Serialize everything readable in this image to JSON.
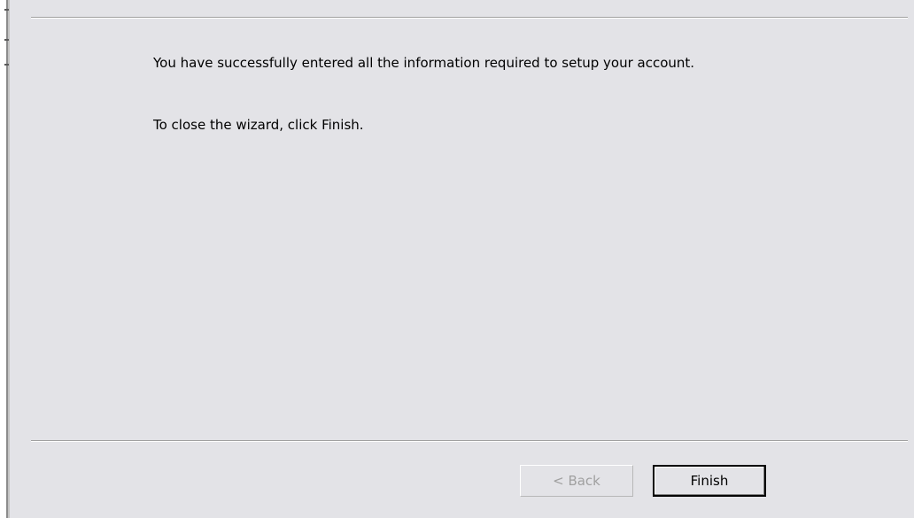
{
  "wizard": {
    "message_line1": "You have successfully entered all the information required to setup your account.",
    "message_line2": "To close the wizard, click Finish."
  },
  "buttons": {
    "back_label": "< Back",
    "back_enabled": false,
    "finish_label": "Finish"
  }
}
